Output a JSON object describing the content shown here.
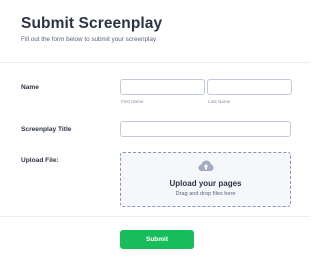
{
  "form": {
    "title": "Submit Screenplay",
    "subtitle": "Fill out the form below to submit your screenplay"
  },
  "fields": {
    "name": {
      "label": "Name",
      "first_value": "",
      "first_placeholder": "",
      "first_sublabel": "First Name",
      "last_value": "",
      "last_placeholder": "",
      "last_sublabel": "Last Name"
    },
    "screenplay_title": {
      "label": "Screenplay Title",
      "value": "",
      "placeholder": ""
    },
    "upload": {
      "label": "Upload File:",
      "icon": "cloud-upload-icon",
      "title": "Upload your pages",
      "hint": "Drag and drop files here"
    }
  },
  "submit": {
    "label": "Submit",
    "color": "#18bd5b"
  },
  "colors": {
    "text": "#2c3345",
    "muted": "#57647e",
    "border": "#c3cad8"
  }
}
